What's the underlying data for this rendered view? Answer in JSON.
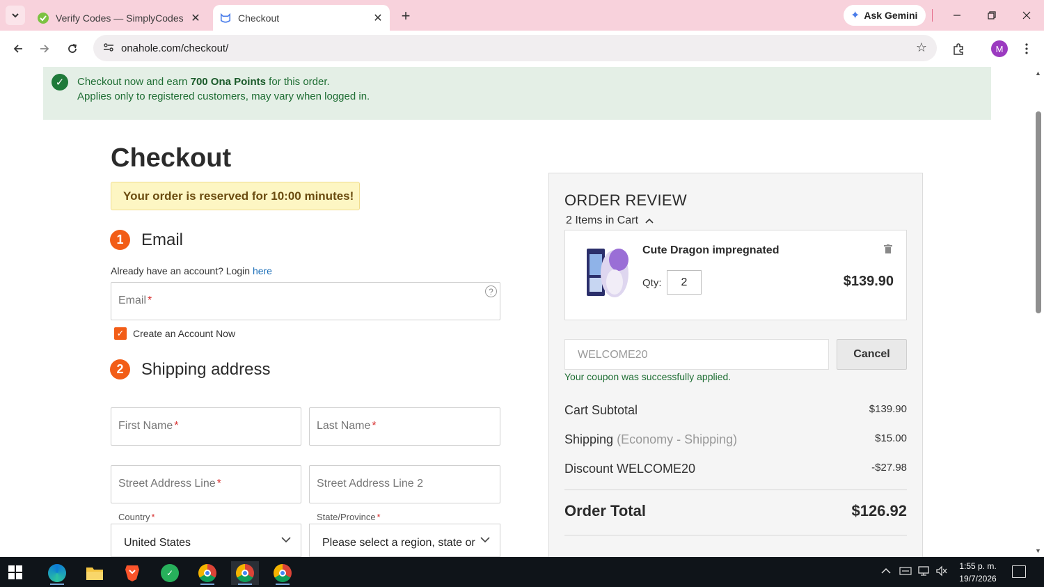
{
  "browser": {
    "tabs": [
      {
        "title": "Verify Codes — SimplyCodes",
        "active": false,
        "favicon_color": "#7cc242"
      },
      {
        "title": "Checkout",
        "active": true,
        "favicon_color": "#4a7dea"
      }
    ],
    "new_tab_label": "+",
    "ask_gemini": "Ask Gemini",
    "url": "onahole.com/checkout/",
    "profile_initial": "M",
    "accent": "#f8d2dc"
  },
  "banner": {
    "prefix": "Checkout now and earn ",
    "points": "700 Ona Points",
    "suffix": " for this order.",
    "line2": "Applies only to registered customers, may vary when logged in."
  },
  "checkout": {
    "title": "Checkout",
    "reserved": "Your order is reserved for 10:00 minutes!",
    "step1": {
      "num": "1",
      "label": "Email"
    },
    "login_prefix": "Already have an account? Login ",
    "login_link": "here",
    "email_placeholder": "Email",
    "req_mark": "*",
    "help_mark": "?",
    "create_account": "Create an Account Now",
    "create_account_checked": true,
    "step2": {
      "num": "2",
      "label": "Shipping address"
    },
    "first_name": "First Name",
    "last_name": "Last Name",
    "street1": "Street Address Line",
    "street2": "Street Address Line 2",
    "country_label": "Country",
    "country_value": "United States",
    "state_label": "State/Province",
    "state_value": "Please select a region, state or"
  },
  "review": {
    "title": "ORDER REVIEW",
    "items_count": "2 Items in Cart",
    "item": {
      "name": "Cute Dragon impregnated",
      "qty_label": "Qty:",
      "qty": "2",
      "price": "$139.90"
    },
    "coupon_code": "WELCOME20",
    "cancel_label": "Cancel",
    "coupon_msg": "Your coupon was successfully applied.",
    "subtotal_label": "Cart Subtotal",
    "subtotal": "$139.90",
    "shipping_label": "Shipping",
    "shipping_method": "(Economy - Shipping)",
    "shipping": "$15.00",
    "discount_label": "Discount WELCOME20",
    "discount": "-$27.98",
    "total_label": "Order Total",
    "total": "$126.92"
  },
  "taskbar": {
    "time": "1:55 p. m.",
    "date": "19/7/2026"
  }
}
